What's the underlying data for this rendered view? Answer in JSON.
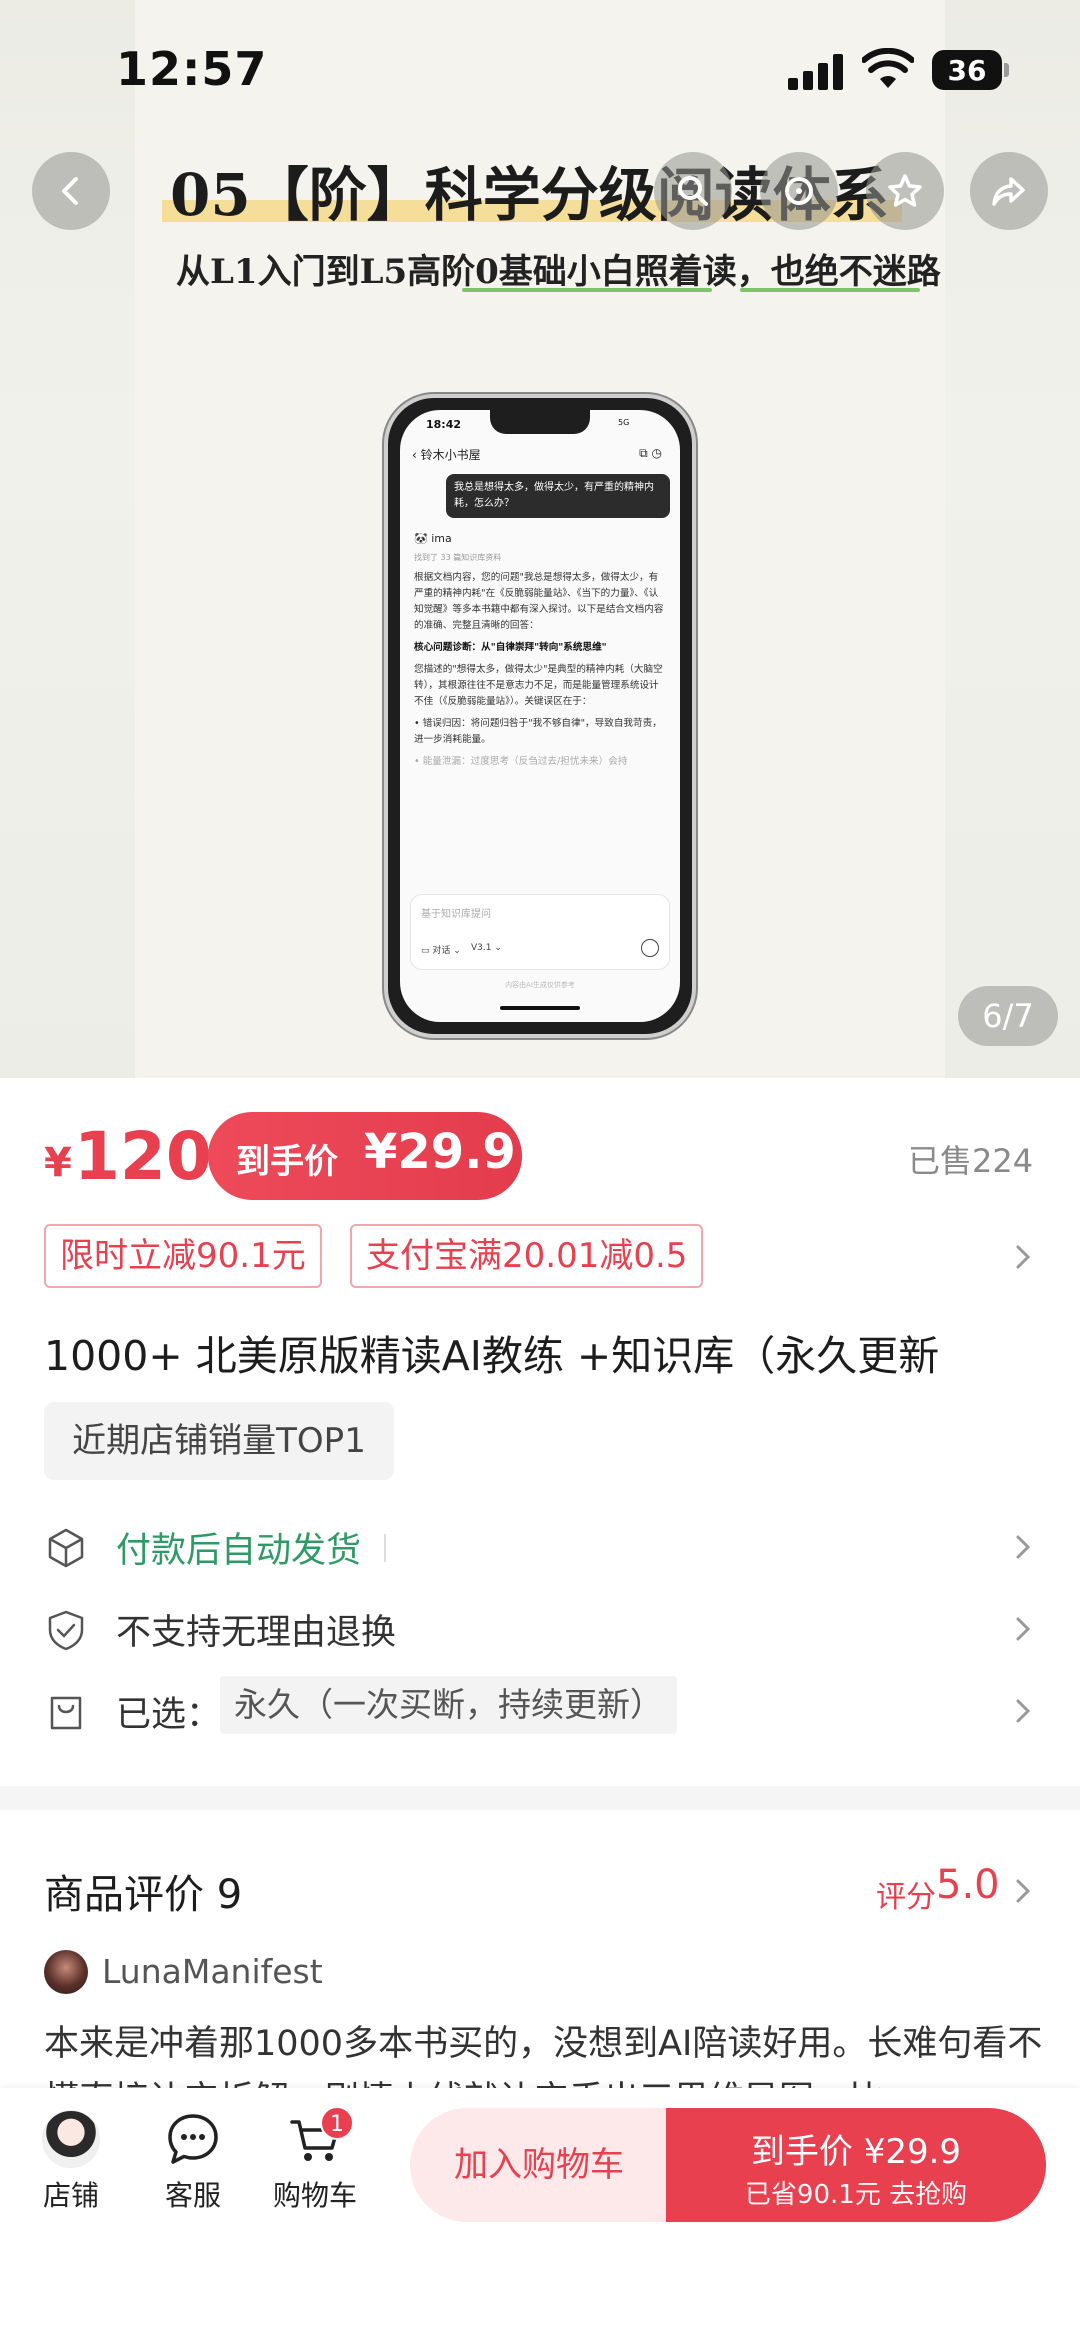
{
  "status_bar": {
    "time": "12:57",
    "battery": "36"
  },
  "hero": {
    "title": "05【阶】科学分级阅读体系",
    "subtitle": "从L1入门到L5高阶0基础小白照着读，也绝不迷路",
    "page_indicator": "6/7",
    "phone": {
      "time": "18:42",
      "status": "5G",
      "header": "铃木小书屋",
      "question": "我总是想得太多，做得太少，有严重的精神内耗，怎么办？",
      "assistant": "ima",
      "found": "找到了 33 篇知识库资料",
      "p1": "根据文档内容，您的问题\"我总是想得太多，做得太少，有严重的精神内耗\"在《反脆弱能量站》、《当下的力量》、《认知觉醒》等多本书籍中都有深入探讨。以下是结合文档内容的准确、完整且清晰的回答：",
      "h2": "核心问题诊断：从\"自律崇拜\"转向\"系统思维\"",
      "p2": "您描述的\"想得太多，做得太少\"是典型的精神内耗（大脑空转），其根源往往不是意志力不足，而是能量管理系统设计不佳（《反脆弱能量站》）。关键误区在于：",
      "p3": "• 错误归因：将问题归咎于\"我不够自律\"，导致自我苛责，进一步消耗能量。",
      "p4": "• 能量泄漏：过度思考（反刍过去/担忧未来）会持",
      "input_placeholder": "基于知识库提问",
      "opt1": "对话",
      "opt2": "V3.1",
      "footer": "内容由AI生成仅供参考"
    }
  },
  "price": {
    "currency": "¥",
    "amount": "120",
    "deal_label": "到手价",
    "deal_price": "¥29.9",
    "sold": "已售224"
  },
  "coupons": [
    "限时立减90.1元",
    "支付宝满20.01减0.5"
  ],
  "product_title": "1000+ 北美原版精读AI教练 +知识库（永久更新",
  "rank_tag": "近期店铺销量TOP1",
  "features": {
    "delivery": "付款后自动发货",
    "refund": "不支持无理由退换",
    "selected_label": "已选：",
    "selected_value": "永久（一次买断，持续更新）"
  },
  "reviews": {
    "title": "商品评价 9",
    "rating_label": "评分",
    "rating": "5.0",
    "user": "LunaManifest",
    "text": "本来是冲着那1000多本书买的，没想到AI陪读好用。长难句看不懂直接让它拆解，剧情上线就让它丢出三思维导图，比"
  },
  "bottom": {
    "shop": "店铺",
    "service": "客服",
    "cart": "购物车",
    "cart_badge": "1",
    "add_cart": "加入购物车",
    "buy_line1": "到手价 ¥29.9",
    "buy_line2": "已省90.1元 去抢购"
  },
  "colors": {
    "accent": "#e8404f",
    "green": "#2f9a66",
    "highlight": "#f3d98a"
  }
}
